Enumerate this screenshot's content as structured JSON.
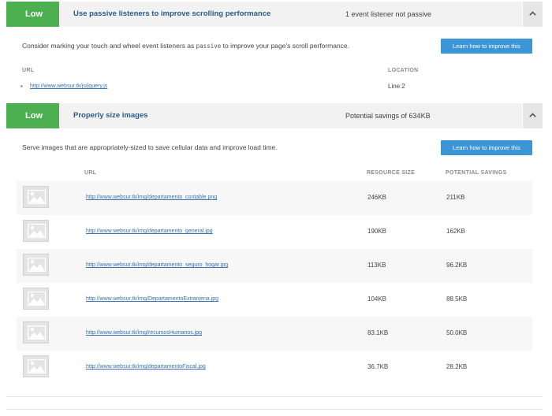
{
  "audits": [
    {
      "badge": "Low",
      "title": "Use passive listeners to improve scrolling performance",
      "summary": "1 event listener not passive",
      "description_before": "Consider marking your touch and wheel event listeners as ",
      "description_code": "passive",
      "description_after": " to improve your page's scroll performance.",
      "learn_label": "Learn how to improve this",
      "columns": {
        "url": "URL",
        "location": "LOCATION"
      },
      "items": [
        {
          "url": "http://www.websur.tk/js/jquery.js",
          "location": "Line:2"
        }
      ]
    },
    {
      "badge": "Low",
      "title": "Properly size images",
      "summary": "Potential savings of 634KB",
      "description": "Serve images that are appropriately-sized to save cellular data and improve load time.",
      "learn_label": "Learn how to improve this",
      "columns": {
        "url": "URL",
        "resource_size": "RESOURCE SIZE",
        "potential_savings": "POTENTIAL SAVINGS"
      },
      "rows": [
        {
          "url": "http://www.websur.tk/img/departamento_contable.png",
          "resource_size": "246KB",
          "potential_savings": "211KB"
        },
        {
          "url": "http://www.websur.tk/img/departamento_general.jpg",
          "resource_size": "190KB",
          "potential_savings": "162KB"
        },
        {
          "url": "http://www.websur.tk/img/departamento_seguro_hogar.jpg",
          "resource_size": "113KB",
          "potential_savings": "96.2KB"
        },
        {
          "url": "http://www.websur.tk/img/DepartamentoExtranjeria.jpg",
          "resource_size": "104KB",
          "potential_savings": "88.5KB"
        },
        {
          "url": "http://www.websur.tk/img/recursosHumanos.jpg",
          "resource_size": "83.1KB",
          "potential_savings": "50.0KB"
        },
        {
          "url": "http://www.websur.tk/img/departamentoFiscal.jpg",
          "resource_size": "36.7KB",
          "potential_savings": "28.2KB"
        }
      ]
    }
  ],
  "icons": {
    "toggle": "chevron-up-icon",
    "thumbnail": "image-placeholder-icon"
  },
  "colors": {
    "badge_low": "#4caf50",
    "title": "#2a5a8a",
    "button": "#3c95d6",
    "link": "#3a6fb0"
  }
}
